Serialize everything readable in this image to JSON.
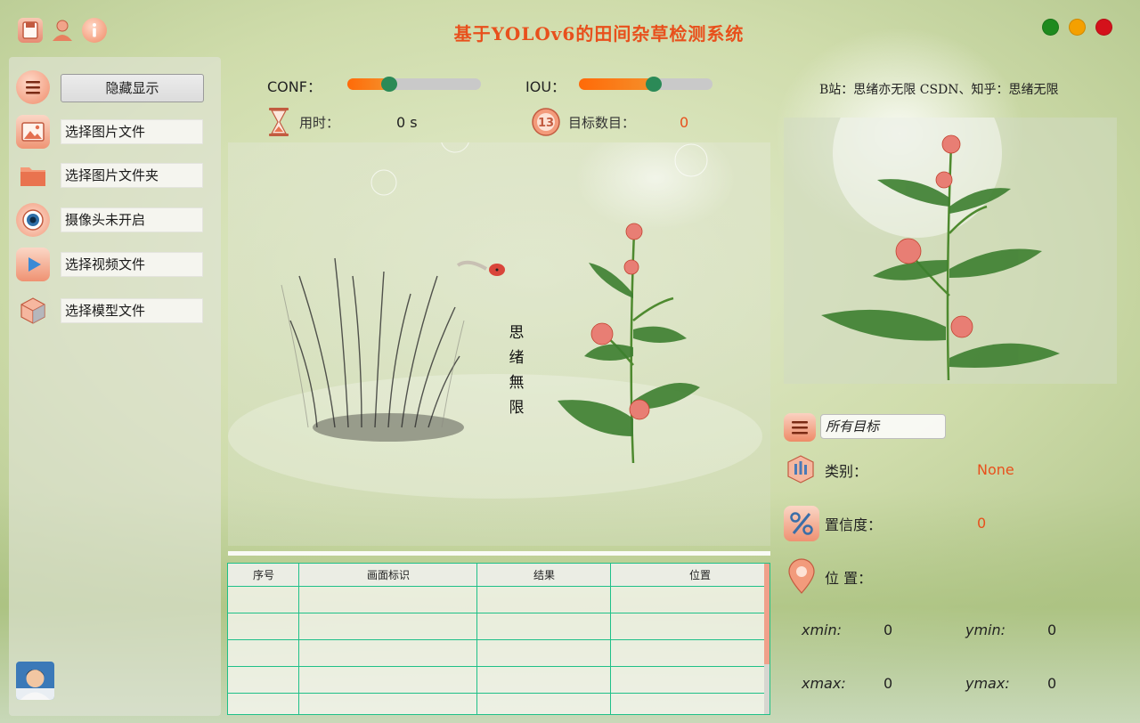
{
  "app": {
    "title": "基于YOLOv6的田间杂草检测系统",
    "toolbar_icons": [
      "save-icon",
      "user-icon",
      "info-icon"
    ],
    "window_buttons": [
      {
        "name": "maximize-button",
        "color": "#1e8a1e"
      },
      {
        "name": "minimize-button",
        "color": "#f4a000"
      },
      {
        "name": "close-button",
        "color": "#d4111b"
      }
    ]
  },
  "sidebar": {
    "toggle_label": "隐藏显示",
    "items": [
      {
        "label": "选择图片文件",
        "icon": "image-icon"
      },
      {
        "label": "选择图片文件夹",
        "icon": "folder-icon"
      },
      {
        "label": "摄像头未开启",
        "icon": "camera-icon"
      },
      {
        "label": "选择视频文件",
        "icon": "video-icon"
      },
      {
        "label": "选择模型文件",
        "icon": "model-cube-icon"
      }
    ]
  },
  "controls": {
    "conf_label": "CONF：",
    "conf_value": 0.25,
    "iou_label": "IOU：",
    "iou_value": 0.5,
    "time_label": "用时：",
    "time_value": "0 s",
    "count_label": "目标数目：",
    "count_value": "0"
  },
  "main_view": {
    "vertical_text": [
      "思",
      "绪",
      "無",
      "限"
    ]
  },
  "table": {
    "columns": [
      "序号",
      "画面标识",
      "结果",
      "位置"
    ],
    "rows": []
  },
  "right_panel": {
    "author_text": "B站：思绪亦无限  CSDN、知乎：思绪无限",
    "target_select_value": "所有目标",
    "class_label": "类别：",
    "class_value": "None",
    "conf_label": "置信度：",
    "conf_value": "0",
    "position_label": "位 置：",
    "xmin_label": "xmin:",
    "xmin_value": "0",
    "ymin_label": "ymin:",
    "ymin_value": "0",
    "xmax_label": "xmax:",
    "xmax_value": "0",
    "ymax_label": "ymax:",
    "ymax_value": "0"
  },
  "colors": {
    "accent": "#e8501c",
    "slider_fill": "#ff6a08",
    "slider_thumb": "#2b8a57",
    "table_border": "#1fc088"
  }
}
